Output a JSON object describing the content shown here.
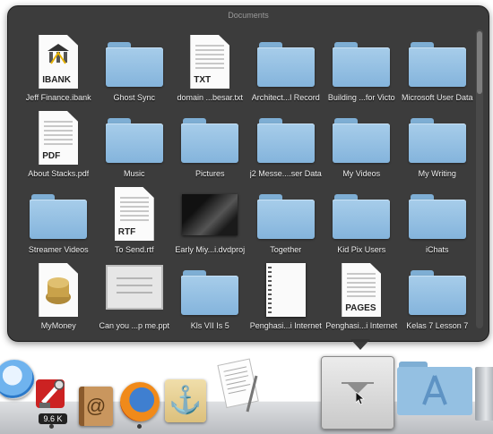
{
  "stack": {
    "title": "Documents",
    "items": [
      {
        "label": "Jeff Finance.ibank",
        "kind": "ibank",
        "ext": "IBANK"
      },
      {
        "label": "Ghost Sync",
        "kind": "folder"
      },
      {
        "label": "domain ...besar.txt",
        "kind": "doc",
        "ext": "TXT"
      },
      {
        "label": "Architect...l Record",
        "kind": "folder"
      },
      {
        "label": "Building ...for Victo",
        "kind": "folder"
      },
      {
        "label": "Microsoft User Data",
        "kind": "folder"
      },
      {
        "label": "About Stacks.pdf",
        "kind": "doc",
        "ext": "PDF"
      },
      {
        "label": "Music",
        "kind": "folder"
      },
      {
        "label": "Pictures",
        "kind": "folder"
      },
      {
        "label": "j2 Messe....ser Data",
        "kind": "folder"
      },
      {
        "label": "My Videos",
        "kind": "folder"
      },
      {
        "label": "My Writing",
        "kind": "folder"
      },
      {
        "label": "Streamer Videos",
        "kind": "folder"
      },
      {
        "label": "To Send.rtf",
        "kind": "doc",
        "ext": "RTF"
      },
      {
        "label": "Early Miy...i.dvdproj",
        "kind": "dark"
      },
      {
        "label": "Together",
        "kind": "folder"
      },
      {
        "label": "Kid Pix Users",
        "kind": "folder"
      },
      {
        "label": "iChats",
        "kind": "folder"
      },
      {
        "label": "MyMoney",
        "kind": "money"
      },
      {
        "label": "Can you ...p me.ppt",
        "kind": "ppt"
      },
      {
        "label": "Kls VII Is 5",
        "kind": "folder"
      },
      {
        "label": "Penghasi...i Internet",
        "kind": "notebook"
      },
      {
        "label": "Penghasi...i Internet",
        "kind": "doc",
        "ext": "PAGES"
      },
      {
        "label": "Kelas 7 Lesson 7",
        "kind": "folder"
      }
    ]
  },
  "dock": {
    "ibank_badge": "9.6 K"
  },
  "colors": {
    "panel": "#343434",
    "folder": "#94c0e2",
    "dock": "#c9ccd0"
  }
}
